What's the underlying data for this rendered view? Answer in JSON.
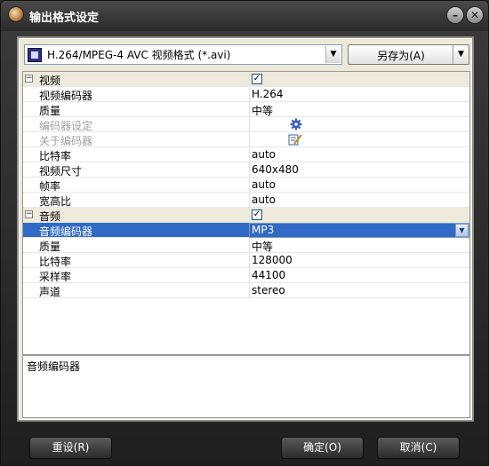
{
  "window": {
    "title": "输出格式设定"
  },
  "format": {
    "selected": "H.264/MPEG-4 AVC 视频格式 (*.avi)",
    "save_as_label": "另存为(A)"
  },
  "grid": {
    "rows": [
      {
        "type": "category",
        "name": "视频",
        "checked": true
      },
      {
        "name": "视频编码器",
        "value": "H.264"
      },
      {
        "name": "质量",
        "value": "中等"
      },
      {
        "name": "编码器设定",
        "value": "",
        "disabled": true,
        "icon": "gear-icon"
      },
      {
        "name": "关于编码器",
        "value": "",
        "disabled": true,
        "icon": "edit-icon"
      },
      {
        "name": "比特率",
        "value": "auto"
      },
      {
        "name": "视频尺寸",
        "value": "640x480"
      },
      {
        "name": "帧率",
        "value": "auto"
      },
      {
        "name": "宽高比",
        "value": "auto"
      },
      {
        "type": "category",
        "name": "音频",
        "checked": true
      },
      {
        "name": "音频编码器",
        "value": "MP3",
        "selected": true
      },
      {
        "name": "质量",
        "value": "中等"
      },
      {
        "name": "比特率",
        "value": "128000"
      },
      {
        "name": "采样率",
        "value": "44100"
      },
      {
        "name": "声道",
        "value": "stereo"
      }
    ]
  },
  "description": {
    "text": "音频编码器"
  },
  "buttons": {
    "reset": "重设(R)",
    "ok": "确定(O)",
    "cancel": "取消(C)"
  },
  "colors": {
    "selection": "#316ac5",
    "category_bg": "#eeebdd",
    "panel_bg": "#ece9d8"
  }
}
